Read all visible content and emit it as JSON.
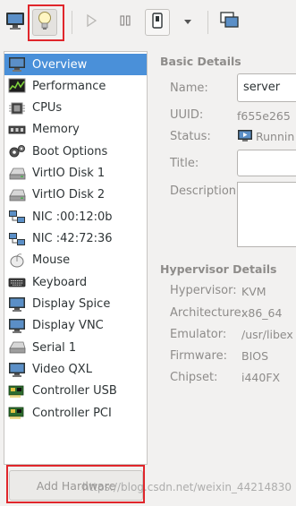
{
  "toolbar": {
    "buttons": [
      {
        "name": "console-view",
        "icon": "monitor-icon"
      },
      {
        "name": "details-view",
        "icon": "lightbulb-icon"
      },
      {
        "name": "run",
        "icon": "play-icon"
      },
      {
        "name": "pause",
        "icon": "pause-icon"
      },
      {
        "name": "shutdown",
        "icon": "power-icon"
      },
      {
        "name": "shutdown-menu",
        "icon": "chevron-down-icon"
      },
      {
        "name": "snapshots",
        "icon": "snapshot-icon"
      }
    ]
  },
  "sidebar": {
    "items": [
      {
        "label": "Overview",
        "icon": "monitor-icon",
        "selected": true
      },
      {
        "label": "Performance",
        "icon": "performance-graph-icon"
      },
      {
        "label": "CPUs",
        "icon": "cpu-chip-icon"
      },
      {
        "label": "Memory",
        "icon": "memory-icon"
      },
      {
        "label": "Boot Options",
        "icon": "gears-icon"
      },
      {
        "label": "VirtIO Disk 1",
        "icon": "hard-disk-icon"
      },
      {
        "label": "VirtIO Disk 2",
        "icon": "hard-disk-icon"
      },
      {
        "label": "NIC :00:12:0b",
        "icon": "network-icon"
      },
      {
        "label": "NIC :42:72:36",
        "icon": "network-icon"
      },
      {
        "label": "Mouse",
        "icon": "mouse-icon"
      },
      {
        "label": "Keyboard",
        "icon": "keyboard-icon"
      },
      {
        "label": "Display Spice",
        "icon": "display-icon"
      },
      {
        "label": "Display VNC",
        "icon": "display-icon"
      },
      {
        "label": "Serial 1",
        "icon": "serial-port-icon"
      },
      {
        "label": "Video QXL",
        "icon": "video-card-icon"
      },
      {
        "label": "Controller USB",
        "icon": "controller-card-icon"
      },
      {
        "label": "Controller PCI",
        "icon": "controller-card-icon"
      }
    ],
    "add_hardware_label": "Add Hardware"
  },
  "basic_details": {
    "title": "Basic Details",
    "name_label": "Name:",
    "name_value": "server",
    "uuid_label": "UUID:",
    "uuid_value": "f655e265",
    "status_label": "Status:",
    "status_value": "Runnin",
    "title_label": "Title:",
    "title_value": "",
    "description_label": "Description:",
    "description_value": ""
  },
  "hypervisor_details": {
    "title": "Hypervisor Details",
    "hypervisor_label": "Hypervisor:",
    "hypervisor_value": "KVM",
    "architecture_label": "Architecture:",
    "architecture_value": "x86_64",
    "emulator_label": "Emulator:",
    "emulator_value": "/usr/libex",
    "firmware_label": "Firmware:",
    "firmware_value": "BIOS",
    "chipset_label": "Chipset:",
    "chipset_value": "i440FX"
  },
  "watermark": "https://blog.csdn.net/weixin_44214830",
  "colors": {
    "selection": "#4a90d9",
    "highlight_box": "#e0262b",
    "window_bg": "#f2f1f0"
  }
}
